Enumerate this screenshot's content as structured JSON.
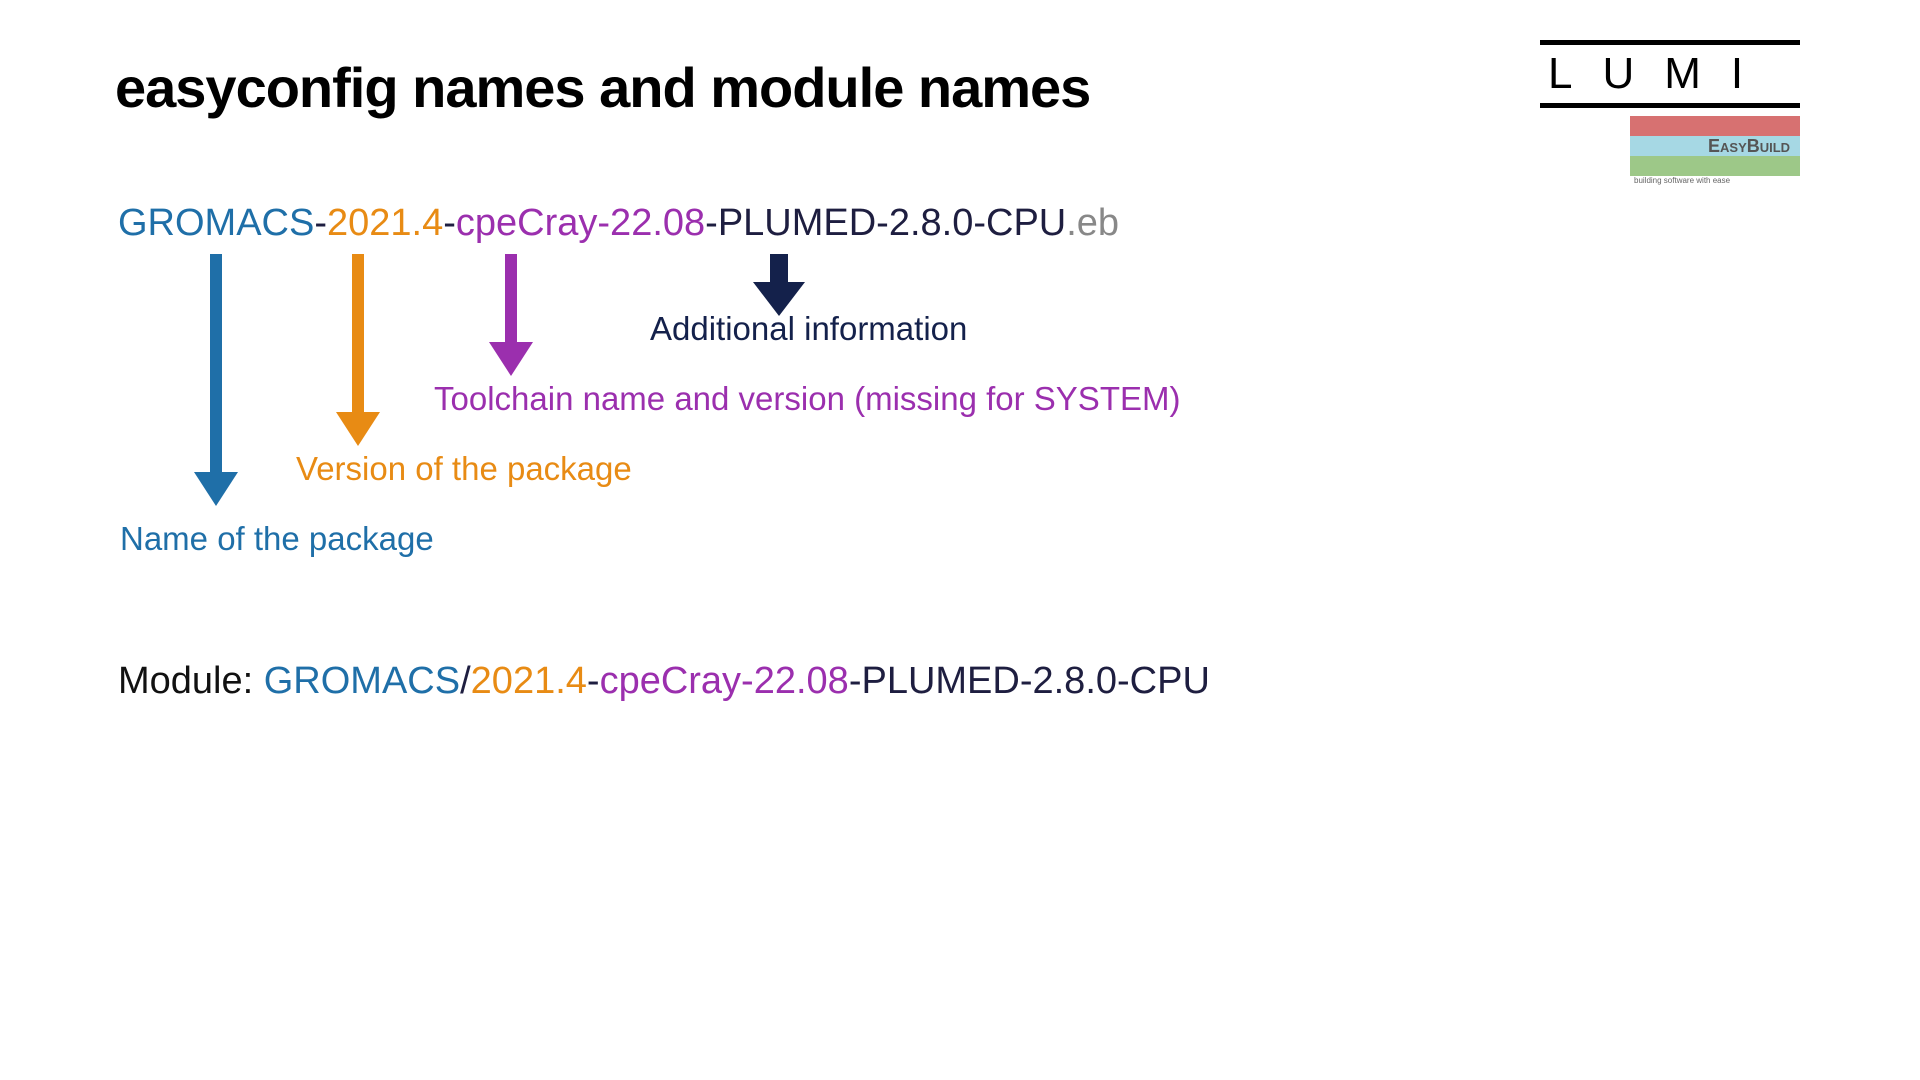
{
  "title": "easyconfig names and module names",
  "logo": {
    "lumi": "LUMI",
    "easybuild": "EasyBuild",
    "tagline": "building software with ease"
  },
  "filename_parts": {
    "name": "GROMACS",
    "version": "2021.4",
    "toolchain": "cpeCray-22.08",
    "suffix": "PLUMED-2.8.0-CPU",
    "ext": ".eb"
  },
  "captions": {
    "name": "Name of the package",
    "version": "Version of the package",
    "toolchain": "Toolchain name and version (missing for SYSTEM)",
    "extra": "Additional information"
  },
  "module": {
    "label": "Module: ",
    "name": "GROMACS",
    "sep": "/",
    "version": "2021.4",
    "toolchain": "cpeCray-22.08",
    "suffix": "PLUMED-2.8.0-CPU"
  }
}
